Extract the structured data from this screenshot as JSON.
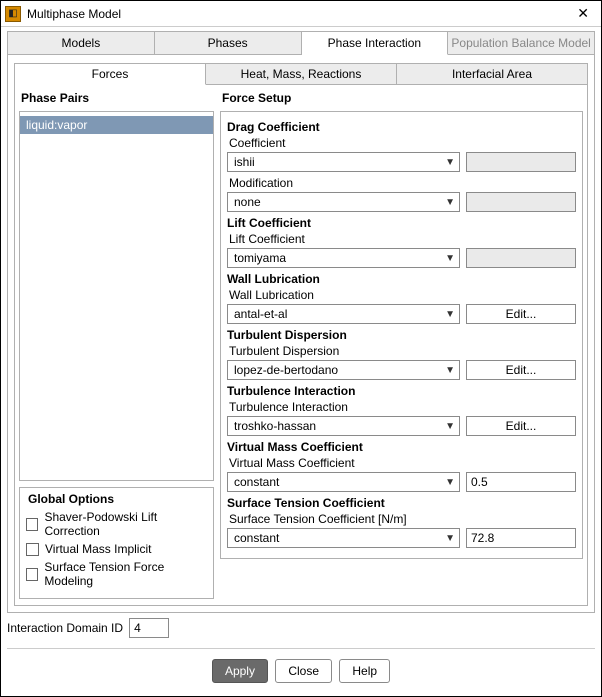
{
  "title": "Multiphase Model",
  "close_symbol": "✕",
  "tabs": {
    "models": "Models",
    "phases": "Phases",
    "phase_interaction": "Phase Interaction",
    "population_balance": "Population Balance Model"
  },
  "subtabs": {
    "forces": "Forces",
    "heat": "Heat, Mass, Reactions",
    "interfacial": "Interfacial Area"
  },
  "phase_pairs_hdr": "Phase Pairs",
  "phase_pairs": [
    "liquid:vapor"
  ],
  "force_setup_hdr": "Force Setup",
  "global_options_hdr": "Global Options",
  "global_options": {
    "shaver": "Shaver-Podowski Lift Correction",
    "vmi": "Virtual Mass Implicit",
    "stfm": "Surface Tension Force Modeling"
  },
  "interaction_domain_label": "Interaction Domain ID",
  "interaction_domain_value": "4",
  "buttons": {
    "apply": "Apply",
    "close": "Close",
    "help": "Help",
    "edit": "Edit..."
  },
  "groups": {
    "drag": {
      "title": "Drag Coefficient",
      "coef_label": "Coefficient",
      "coef_value": "ishii",
      "mod_label": "Modification",
      "mod_value": "none"
    },
    "lift": {
      "title": "Lift Coefficient",
      "label": "Lift Coefficient",
      "value": "tomiyama"
    },
    "wall": {
      "title": "Wall Lubrication",
      "label": "Wall Lubrication",
      "value": "antal-et-al"
    },
    "turbdisp": {
      "title": "Turbulent Dispersion",
      "label": "Turbulent Dispersion",
      "value": "lopez-de-bertodano"
    },
    "turbint": {
      "title": "Turbulence Interaction",
      "label": "Turbulence Interaction",
      "value": "troshko-hassan"
    },
    "vmass": {
      "title": "Virtual Mass Coefficient",
      "label": "Virtual Mass Coefficient",
      "dropdown": "constant",
      "value": "0.5"
    },
    "surft": {
      "title": "Surface Tension Coefficient",
      "label": "Surface Tension Coefficient [N/m]",
      "dropdown": "constant",
      "value": "72.8"
    }
  }
}
